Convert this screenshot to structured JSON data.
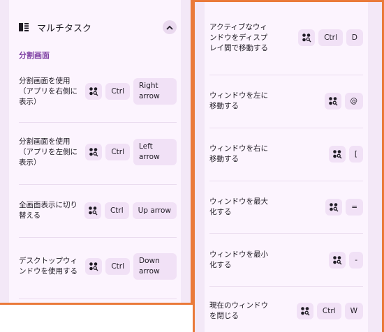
{
  "header": {
    "title": "マルチタスク"
  },
  "section": {
    "title": "分割画面"
  },
  "left_rows": [
    {
      "label": "分割画面を使用（アプリを右側に表示）",
      "keys": [
        "search",
        "Ctrl",
        "Right arrow"
      ]
    },
    {
      "label": "分割画面を使用（アプリを左側に表示）",
      "keys": [
        "search",
        "Ctrl",
        "Left arrow"
      ]
    },
    {
      "label": "全画面表示に切り替える",
      "keys": [
        "search",
        "Ctrl",
        "Up arrow"
      ]
    },
    {
      "label": "デスクトップウィンドウを使用する",
      "keys": [
        "search",
        "Ctrl",
        "Down arrow"
      ]
    }
  ],
  "right_rows": [
    {
      "label": "アクティブなウィンドウをディスプレイ間で移動する",
      "keys": [
        "search",
        "Ctrl",
        "D"
      ]
    },
    {
      "label": "ウィンドウを左に移動する",
      "keys": [
        "search",
        "@"
      ]
    },
    {
      "label": "ウィンドウを右に移動する",
      "keys": [
        "search",
        "["
      ]
    },
    {
      "label": "ウィンドウを最大化する",
      "keys": [
        "search",
        "="
      ]
    },
    {
      "label": "ウィンドウを最小化する",
      "keys": [
        "search",
        "-"
      ]
    },
    {
      "label": "現在のウィンドウを閉じる",
      "keys": [
        "search",
        "Ctrl",
        "W"
      ]
    }
  ]
}
